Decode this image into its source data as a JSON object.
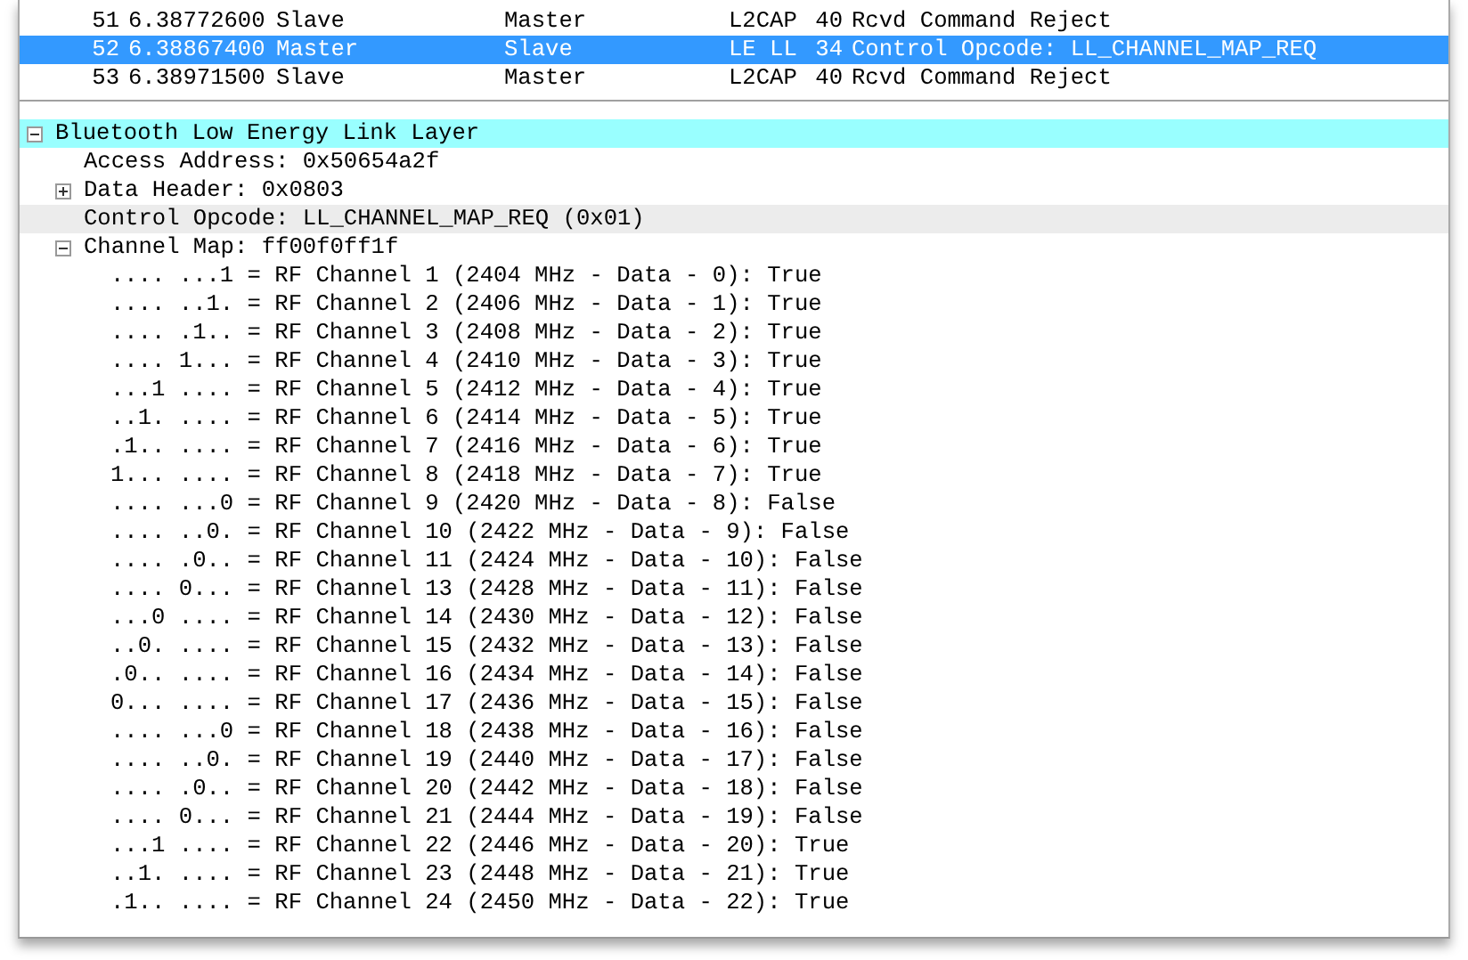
{
  "packet_list": {
    "rows": [
      {
        "no": "51",
        "time": "6.38772600",
        "source": "Slave",
        "destination": "Master",
        "protocol": "L2CAP",
        "length": "40",
        "info": "Rcvd Command Reject",
        "selected": false
      },
      {
        "no": "52",
        "time": "6.38867400",
        "source": "Master",
        "destination": "Slave",
        "protocol": "LE LL",
        "length": "34",
        "info": "Control Opcode: LL_CHANNEL_MAP_REQ",
        "selected": true
      },
      {
        "no": "53",
        "time": "6.38971500",
        "source": "Slave",
        "destination": "Master",
        "protocol": "L2CAP",
        "length": "40",
        "info": "Rcvd Command Reject",
        "selected": false
      }
    ]
  },
  "details": {
    "tree": [
      {
        "label": "Bluetooth Low Energy Link Layer",
        "selected": true,
        "expanded": true,
        "children": [
          {
            "label": "Access Address: 0x50654a2f",
            "selected": false,
            "hovered": false
          },
          {
            "label": "Data Header: 0x0803",
            "selected": false,
            "hovered": false,
            "expanded": false
          },
          {
            "label": "Control Opcode: LL_CHANNEL_MAP_REQ (0x01)",
            "selected": false,
            "hovered": true
          },
          {
            "label": "Channel Map: ff00f0ff1f",
            "selected": false,
            "hovered": false,
            "expanded": true,
            "children": [
              {
                "label": ".... ...1 = RF Channel 1 (2404 MHz - Data - 0): True"
              },
              {
                "label": ".... ..1. = RF Channel 2 (2406 MHz - Data - 1): True"
              },
              {
                "label": ".... .1.. = RF Channel 3 (2408 MHz - Data - 2): True"
              },
              {
                "label": ".... 1... = RF Channel 4 (2410 MHz - Data - 3): True"
              },
              {
                "label": "...1 .... = RF Channel 5 (2412 MHz - Data - 4): True"
              },
              {
                "label": "..1. .... = RF Channel 6 (2414 MHz - Data - 5): True"
              },
              {
                "label": ".1.. .... = RF Channel 7 (2416 MHz - Data - 6): True"
              },
              {
                "label": "1... .... = RF Channel 8 (2418 MHz - Data - 7): True"
              },
              {
                "label": ".... ...0 = RF Channel 9 (2420 MHz - Data - 8): False"
              },
              {
                "label": ".... ..0. = RF Channel 10 (2422 MHz - Data - 9): False"
              },
              {
                "label": ".... .0.. = RF Channel 11 (2424 MHz - Data - 10): False"
              },
              {
                "label": ".... 0... = RF Channel 13 (2428 MHz - Data - 11): False"
              },
              {
                "label": "...0 .... = RF Channel 14 (2430 MHz - Data - 12): False"
              },
              {
                "label": "..0. .... = RF Channel 15 (2432 MHz - Data - 13): False"
              },
              {
                "label": ".0.. .... = RF Channel 16 (2434 MHz - Data - 14): False"
              },
              {
                "label": "0... .... = RF Channel 17 (2436 MHz - Data - 15): False"
              },
              {
                "label": ".... ...0 = RF Channel 18 (2438 MHz - Data - 16): False"
              },
              {
                "label": ".... ..0. = RF Channel 19 (2440 MHz - Data - 17): False"
              },
              {
                "label": ".... .0.. = RF Channel 20 (2442 MHz - Data - 18): False"
              },
              {
                "label": ".... 0... = RF Channel 21 (2444 MHz - Data - 19): False"
              },
              {
                "label": "...1 .... = RF Channel 22 (2446 MHz - Data - 20): True"
              },
              {
                "label": "..1. .... = RF Channel 23 (2448 MHz - Data - 21): True"
              },
              {
                "label": ".1.. .... = RF Channel 24 (2450 MHz - Data - 22): True"
              }
            ]
          }
        ]
      }
    ]
  }
}
